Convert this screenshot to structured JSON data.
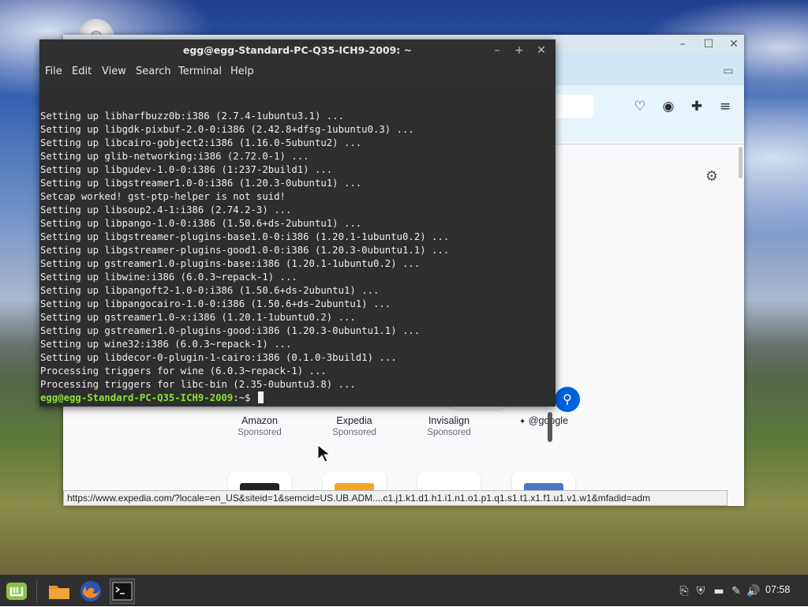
{
  "colors": {
    "terminal_bg": "#2e2e2e",
    "prompt_green": "#8ae234",
    "browser_accent": "#0061e0",
    "taskbar": "#2f2f2f"
  },
  "browser": {
    "shortcuts": [
      {
        "name": "Amazon",
        "sub": "Sponsored"
      },
      {
        "name": "Expedia",
        "sub": "Sponsored"
      },
      {
        "name": "Invisalign",
        "sub": "Sponsored"
      },
      {
        "name": "@google",
        "sub": ""
      }
    ],
    "status_url": "https://www.expedia.com/?locale=en_US&siteid=1&semcid=US.UB.ADM....c1.j1.k1.d1.h1.i1.n1.o1.p1.q1.s1.t1.x1.f1.u1.v1.w1&mfadid=adm"
  },
  "terminal": {
    "title": "egg@egg-Standard-PC-Q35-ICH9-2009: ~",
    "menu": [
      "File",
      "Edit",
      "View",
      "Search",
      "Terminal",
      "Help"
    ],
    "lines": [
      "Setting up libharfbuzz0b:i386 (2.7.4-1ubuntu3.1) ...",
      "Setting up libgdk-pixbuf-2.0-0:i386 (2.42.8+dfsg-1ubuntu0.3) ...",
      "Setting up libcairo-gobject2:i386 (1.16.0-5ubuntu2) ...",
      "Setting up glib-networking:i386 (2.72.0-1) ...",
      "Setting up libgudev-1.0-0:i386 (1:237-2build1) ...",
      "Setting up libgstreamer1.0-0:i386 (1.20.3-0ubuntu1) ...",
      "Setcap worked! gst-ptp-helper is not suid!",
      "Setting up libsoup2.4-1:i386 (2.74.2-3) ...",
      "Setting up libpango-1.0-0:i386 (1.50.6+ds-2ubuntu1) ...",
      "Setting up libgstreamer-plugins-base1.0-0:i386 (1.20.1-1ubuntu0.2) ...",
      "Setting up libgstreamer-plugins-good1.0-0:i386 (1.20.3-0ubuntu1.1) ...",
      "Setting up gstreamer1.0-plugins-base:i386 (1.20.1-1ubuntu0.2) ...",
      "Setting up libwine:i386 (6.0.3~repack-1) ...",
      "Setting up libpangoft2-1.0-0:i386 (1.50.6+ds-2ubuntu1) ...",
      "Setting up libpangocairo-1.0-0:i386 (1.50.6+ds-2ubuntu1) ...",
      "Setting up gstreamer1.0-x:i386 (1.20.1-1ubuntu0.2) ...",
      "Setting up gstreamer1.0-plugins-good:i386 (1.20.3-0ubuntu1.1) ...",
      "Setting up wine32:i386 (6.0.3~repack-1) ...",
      "Setting up libdecor-0-plugin-1-cairo:i386 (0.1.0-3build1) ...",
      "Processing triggers for wine (6.0.3~repack-1) ...",
      "Processing triggers for libc-bin (2.35-0ubuntu3.8) ..."
    ],
    "prompt_user": "egg@egg-Standard-PC-Q35-ICH9-2009",
    "prompt_suffix": ":~$ "
  },
  "taskbar": {
    "apps": [
      "menu-icon",
      "files-icon",
      "firefox-icon",
      "terminal-icon"
    ],
    "clock": "07:58"
  }
}
